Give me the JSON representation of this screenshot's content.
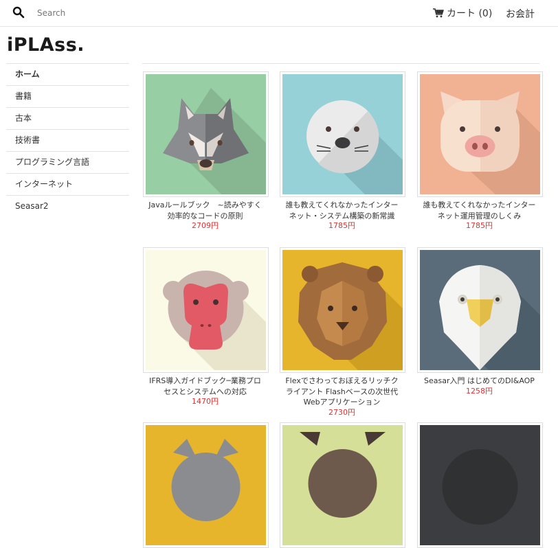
{
  "header": {
    "search_placeholder": "Search",
    "cart_label": "カート (0)",
    "checkout_label": "お会計"
  },
  "logo": "iPLAss.",
  "sidebar": {
    "items": [
      {
        "label": "ホーム"
      },
      {
        "label": "書籍"
      },
      {
        "label": "古本"
      },
      {
        "label": "技術書"
      },
      {
        "label": "プログラミング言語"
      },
      {
        "label": "インターネット"
      },
      {
        "label": "Seasar2"
      }
    ]
  },
  "products": [
    {
      "title": "Javaルールブック　~読みやすく効率的なコードの原則",
      "price": "2709円",
      "image": "wolf-icon",
      "bg": "#98cea3"
    },
    {
      "title": "誰も教えてくれなかったインターネット・システム構築の新常識",
      "price": "1785円",
      "image": "seal-icon",
      "bg": "#96d1d8"
    },
    {
      "title": "誰も教えてくれなかったインターネット運用管理のしくみ",
      "price": "1785円",
      "image": "pig-icon",
      "bg": "#f1b293"
    },
    {
      "title": "IFRS導入ガイドブック─業務プロセスとシステムへの対応",
      "price": "1470円",
      "image": "monkey-icon",
      "bg": "#fbfae6"
    },
    {
      "title": "Flexでさわっておぼえるリッチクライアント Flashベースの次世代Webアプリケーション",
      "price": "2730円",
      "image": "lion-icon",
      "bg": "#e6b52c"
    },
    {
      "title": "Seasar入門 はじめてのDI&AOP",
      "price": "1258円",
      "image": "eagle-icon",
      "bg": "#5a6c7a"
    },
    {
      "image": "cat-icon",
      "bg": "#e6b52c"
    },
    {
      "image": "fox-icon",
      "bg": "#d6df98"
    },
    {
      "image": "bear-icon",
      "bg": "#3b3d40"
    }
  ]
}
